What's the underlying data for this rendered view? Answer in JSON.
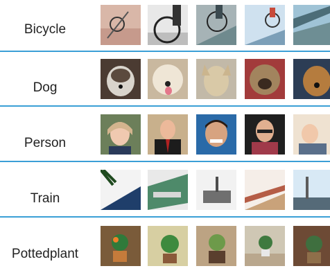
{
  "categories": [
    {
      "label": "Bicycle",
      "thumbs": [
        "bicycle-photo",
        "bicycle-photo",
        "bicycle-photo",
        "bicycle-photo",
        "bicycle-photo"
      ]
    },
    {
      "label": "Dog",
      "thumbs": [
        "dog-photo",
        "dog-photo",
        "dog-photo",
        "dog-photo",
        "dog-photo"
      ]
    },
    {
      "label": "Person",
      "thumbs": [
        "person-photo",
        "person-photo",
        "person-photo",
        "person-photo",
        "person-photo"
      ]
    },
    {
      "label": "Train",
      "thumbs": [
        "train-photo",
        "train-photo",
        "train-photo",
        "train-photo",
        "train-photo"
      ]
    },
    {
      "label": "Pottedplant",
      "thumbs": [
        "pottedplant-photo",
        "pottedplant-photo",
        "pottedplant-photo",
        "pottedplant-photo",
        "pottedplant-photo"
      ]
    }
  ],
  "colors": {
    "divider": "#3a9fd6"
  }
}
